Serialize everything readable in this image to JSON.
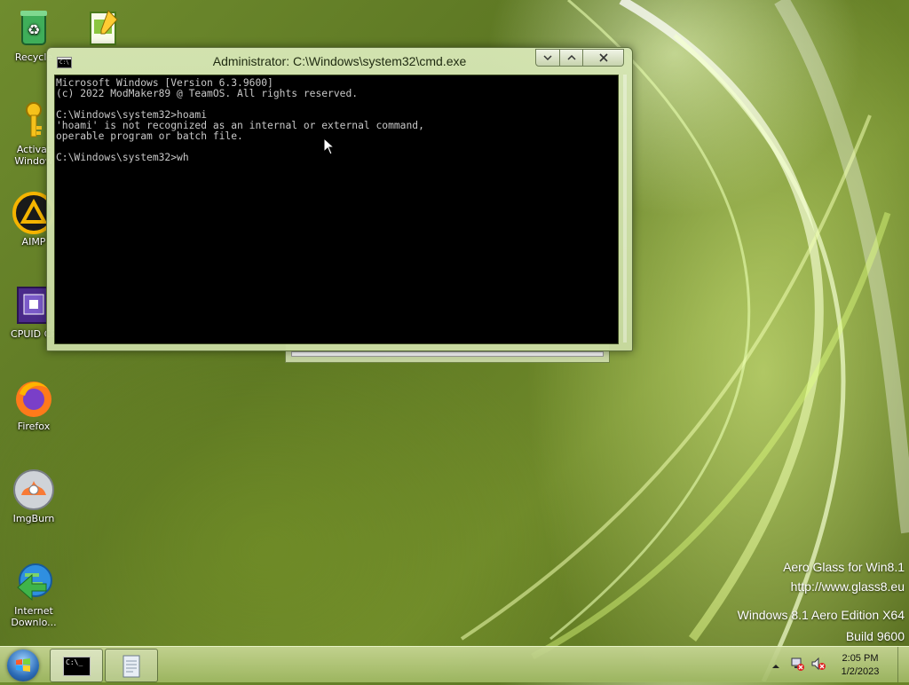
{
  "desktop": {
    "icons": [
      {
        "label": "Recycle"
      },
      {
        "label": ""
      },
      {
        "label": "Activat Window"
      },
      {
        "label": "AIMP"
      },
      {
        "label": "CPUID CP"
      },
      {
        "label": "Firefox"
      },
      {
        "label": "ImgBurn"
      },
      {
        "label": "Internet Downlo..."
      }
    ],
    "branding": {
      "line1": "Aero Glass for Win8.1",
      "line2": "http://www.glass8.eu",
      "line3": "Windows 8.1 Aero Edition X64",
      "line4": "Build 9600"
    }
  },
  "cmd_window": {
    "title": "Administrator: C:\\Windows\\system32\\cmd.exe",
    "icon_text": "C:\\",
    "console_lines": [
      "Microsoft Windows [Version 6.3.9600]",
      "(c) 2022 ModMaker89 @ TeamOS. All rights reserved.",
      "",
      "C:\\Windows\\system32>hoami",
      "'hoami' is not recognized as an internal or external command,",
      "operable program or batch file.",
      "",
      "C:\\Windows\\system32>wh"
    ]
  },
  "taskbar": {
    "cmd_button_text": "C:\\_",
    "clock_time": "2:05 PM",
    "clock_date": "1/2/2023"
  },
  "colors": {
    "accent_green": "#6f8c2e",
    "console_bg": "#000000",
    "console_fg": "#c8c8c8"
  }
}
